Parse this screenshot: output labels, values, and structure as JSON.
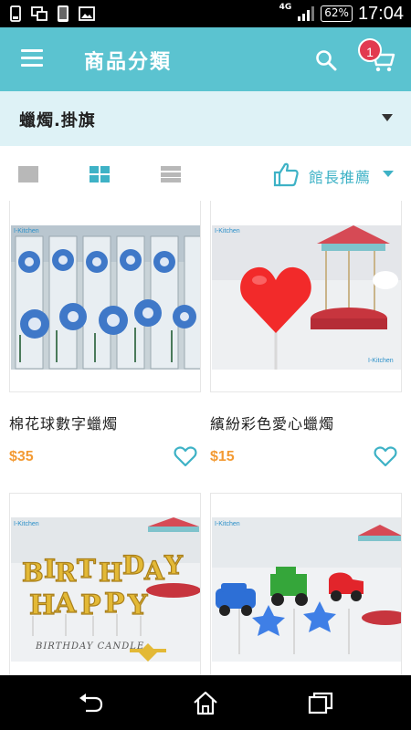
{
  "status_bar": {
    "network": "4G",
    "battery": "62%",
    "time": "17:04"
  },
  "app_bar": {
    "title": "商品分類",
    "cart_count": "1"
  },
  "category": {
    "selected": "蠟燭.掛旗"
  },
  "toolbar": {
    "sort_label": "館長推薦"
  },
  "products": [
    {
      "name": "棉花球數字蠟燭",
      "price": "$35",
      "watermark": "I-Kitchen"
    },
    {
      "name": "繽紛彩色愛心蠟燭",
      "price": "$15",
      "watermark": "I-Kitchen",
      "watermark2": "I-Kitchen"
    },
    {
      "name": "",
      "price": "",
      "watermark": "I-Kitchen",
      "photo_text": "BIRTHDAY CANDLE"
    },
    {
      "name": "",
      "price": "",
      "watermark": "I-Kitchen"
    }
  ],
  "colors": {
    "brand": "#5bc3d0",
    "accent": "#3eb2c6",
    "price": "#f39a33",
    "badge": "#e23a50",
    "category_bg": "#def2f6"
  },
  "icons": [
    "menu-icon",
    "search-icon",
    "cart-icon",
    "dropdown-caret-icon",
    "single-view-icon",
    "grid-view-icon",
    "list-view-icon",
    "thumbs-up-icon",
    "heart-icon",
    "back-icon",
    "home-icon",
    "recents-icon"
  ]
}
